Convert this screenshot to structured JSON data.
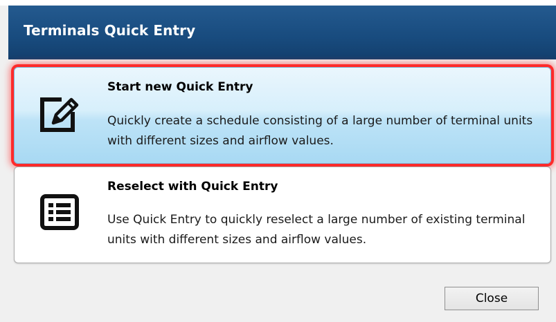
{
  "window": {
    "title": "Terminals Quick Entry"
  },
  "options": [
    {
      "title": "Start new Quick Entry",
      "description": "Quickly create a schedule consisting of a large number of terminal units with different sizes and airflow values.",
      "icon": "edit-pencil-icon",
      "selected": true
    },
    {
      "title": "Reselect with Quick Entry",
      "description": "Use Quick Entry to quickly reselect a large number of existing terminal units with different sizes and airflow values.",
      "icon": "list-icon",
      "selected": false
    }
  ],
  "footer": {
    "close_label": "Close"
  },
  "colors": {
    "title_bar": "#184b7e",
    "selected_highlight": "#ff2b2b",
    "selected_fill": "#bde3f7"
  }
}
